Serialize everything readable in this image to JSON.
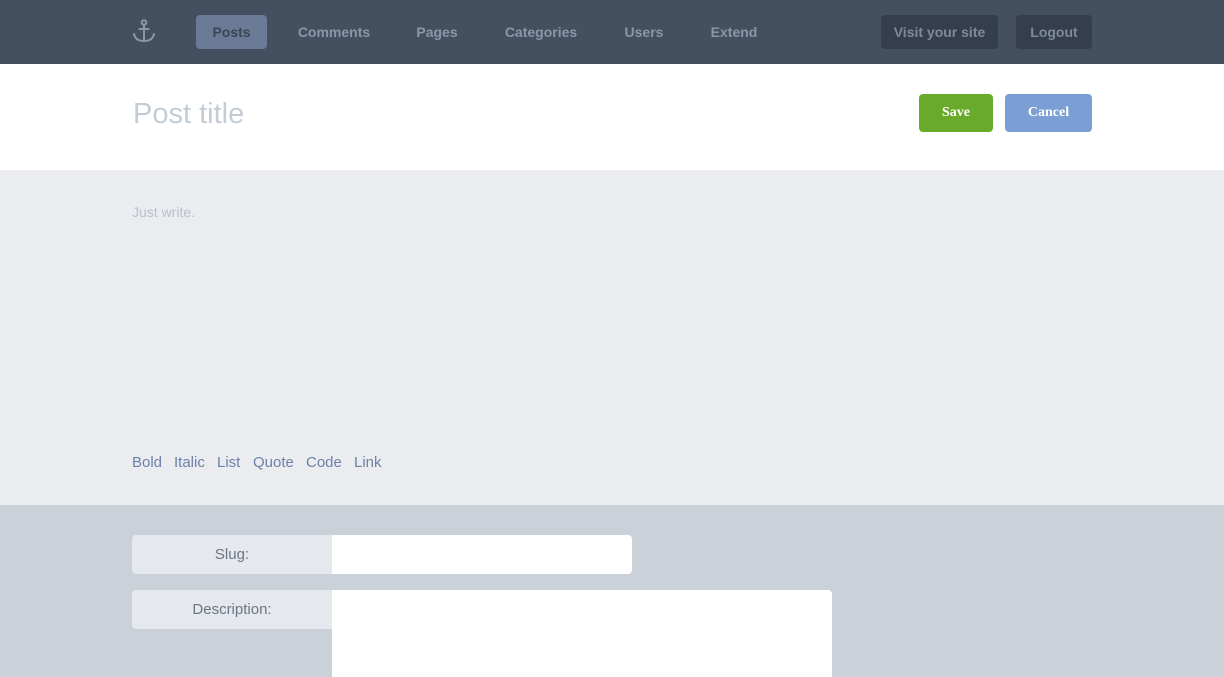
{
  "nav": {
    "logo_icon": "anchor-icon",
    "items": [
      {
        "label": "Posts",
        "active": true
      },
      {
        "label": "Comments",
        "active": false
      },
      {
        "label": "Pages",
        "active": false
      },
      {
        "label": "Categories",
        "active": false
      },
      {
        "label": "Users",
        "active": false
      },
      {
        "label": "Extend",
        "active": false
      }
    ],
    "visit_site_label": "Visit your site",
    "logout_label": "Logout"
  },
  "post": {
    "title_placeholder": "Post title",
    "title_value": "",
    "save_label": "Save",
    "cancel_label": "Cancel"
  },
  "editor": {
    "placeholder": "Just write.",
    "value": "",
    "format_buttons": [
      "Bold",
      "Italic",
      "List",
      "Quote",
      "Code",
      "Link"
    ]
  },
  "meta": {
    "slug_label": "Slug:",
    "slug_value": "",
    "description_label": "Description:",
    "description_value": ""
  },
  "colors": {
    "topbar": "#444f5f",
    "nav_active": "#6b7b97",
    "save": "#6aaa2a",
    "cancel": "#7b9fd4",
    "editor_bg": "#ebecf0",
    "meta_bg": "#cbd1d9"
  }
}
